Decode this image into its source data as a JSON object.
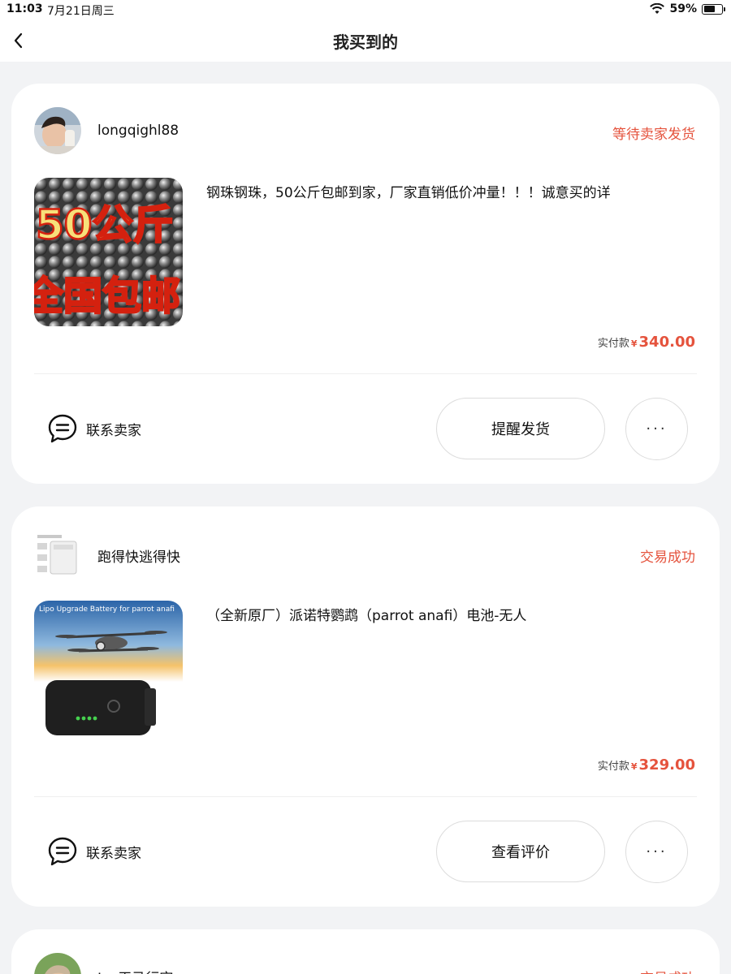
{
  "status_bar": {
    "time": "11:03",
    "date": "7月21日周三",
    "battery": "59%"
  },
  "nav": {
    "title": "我买到的"
  },
  "orders": [
    {
      "seller": "longqighl88",
      "status": "等待卖家发货",
      "title": "钢珠钢珠，50公斤包邮到家，厂家直销低价冲量！！！诚意买的详",
      "thumb_text_1": "50公斤",
      "thumb_text_2": "全国包邮",
      "price_label": "实付款",
      "currency": "¥",
      "price": "340.00",
      "contact_label": "联系卖家",
      "action_label": "提醒发货",
      "more_label": "···"
    },
    {
      "seller": "跑得快逃得快",
      "status": "交易成功",
      "title": "（全新原厂）派诺特鹦鹉（parrot anafi）电池-无人",
      "thumb_caption": "Lipo Upgrade Battery for parrot anafi",
      "price_label": "实付款",
      "currency": "¥",
      "price": "329.00",
      "contact_label": "联系卖家",
      "action_label": "查看评价",
      "more_label": "···"
    },
    {
      "seller": "Lu 天马行空",
      "status": "交易成功"
    }
  ],
  "colors": {
    "accent": "#e5533d",
    "background": "#f2f3f5"
  }
}
